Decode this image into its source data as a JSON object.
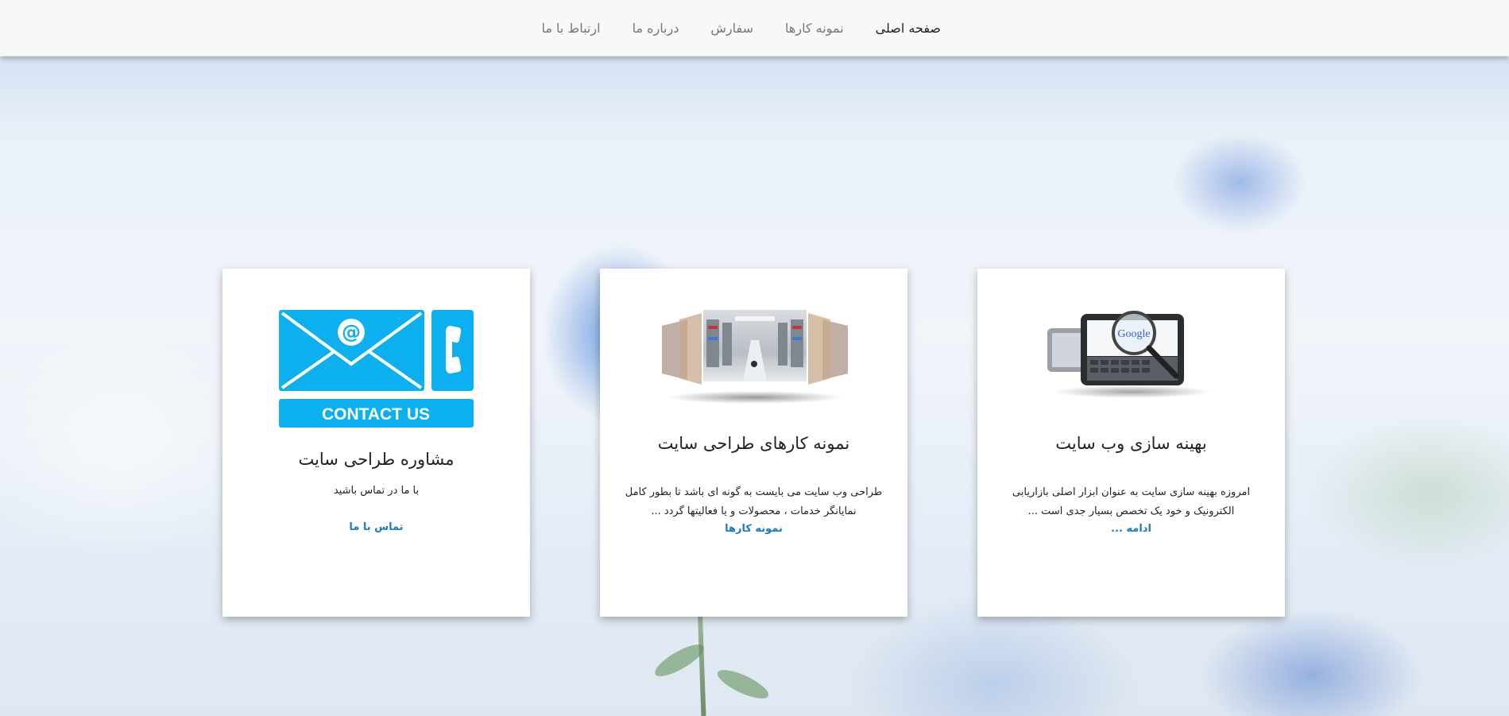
{
  "nav": {
    "items": [
      {
        "label": "صفحه اصلی",
        "active": true
      },
      {
        "label": "نمونه کارها",
        "active": false
      },
      {
        "label": "سفارش",
        "active": false
      },
      {
        "label": "درباره ما",
        "active": false
      },
      {
        "label": "ارتباط با ما",
        "active": false
      }
    ]
  },
  "cards": [
    {
      "image": "seo-tablet-magnifier-google",
      "title": "بهینه سازی وب سایت",
      "text": "امروزه بهینه سازی سایت به عنوان ابزار اصلی بازاریابی الکترونیک و خود یک تخصص بسیار جدی است ...",
      "link": "ادامه ..."
    },
    {
      "image": "portfolio-store-gallery",
      "title": "نمونه کارهای طراحی سایت",
      "text": "طراحی وب سایت می بایست به گونه ای باشد تا بطور کامل نمایانگر خدمات ، محصولات و یا فعالیتها گردد ...",
      "link": "نمونه کارها"
    },
    {
      "image": "contact-us-envelope-phone",
      "image_caption": "CONTACT US",
      "title": "مشاوره طراحی سایت",
      "text": "با ما در تماس باشید",
      "link": "تماس با ما"
    }
  ],
  "colors": {
    "accent": "#1a7bc9",
    "contact_blue": "#0db0ee",
    "nav_bg": "#f7f8fa"
  }
}
